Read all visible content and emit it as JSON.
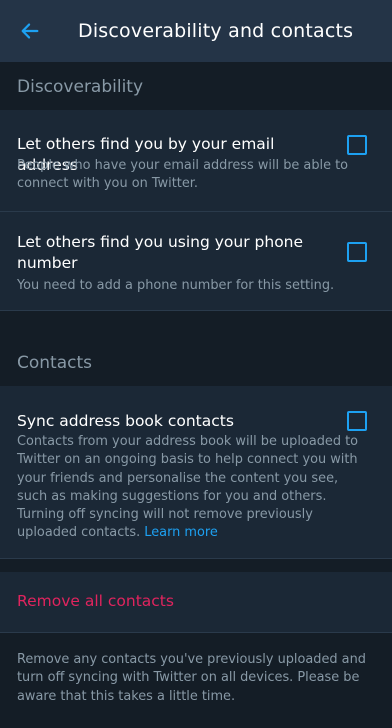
{
  "header": {
    "title": "Discoverability and contacts",
    "back_icon": "arrow-left-icon",
    "accent": "#1da1f2"
  },
  "discoverability": {
    "heading": "Discoverability",
    "email": {
      "title": "Let others find you by your email address",
      "description": "People who have your email address will be able to connect with you on Twitter.",
      "checked": false
    },
    "phone": {
      "title": "Let others find you using your phone number",
      "description": "You need to add a phone number for this setting.",
      "checked": false
    }
  },
  "contacts": {
    "heading": "Contacts",
    "sync": {
      "title": "Sync address book contacts",
      "description": "Contacts from your address book will be uploaded to Twitter on an ongoing basis to help connect you with your friends and personalise the content you see, such as making suggestions for you and others. Turning off syncing will not remove previously uploaded contacts.",
      "learn_more": "Learn more",
      "checked": false
    },
    "remove": {
      "label": "Remove all contacts",
      "description": "Remove any contacts you've previously uploaded and turn off syncing with Twitter on all devices. Please be aware that this takes a little time.",
      "color": "#e0245e"
    }
  }
}
